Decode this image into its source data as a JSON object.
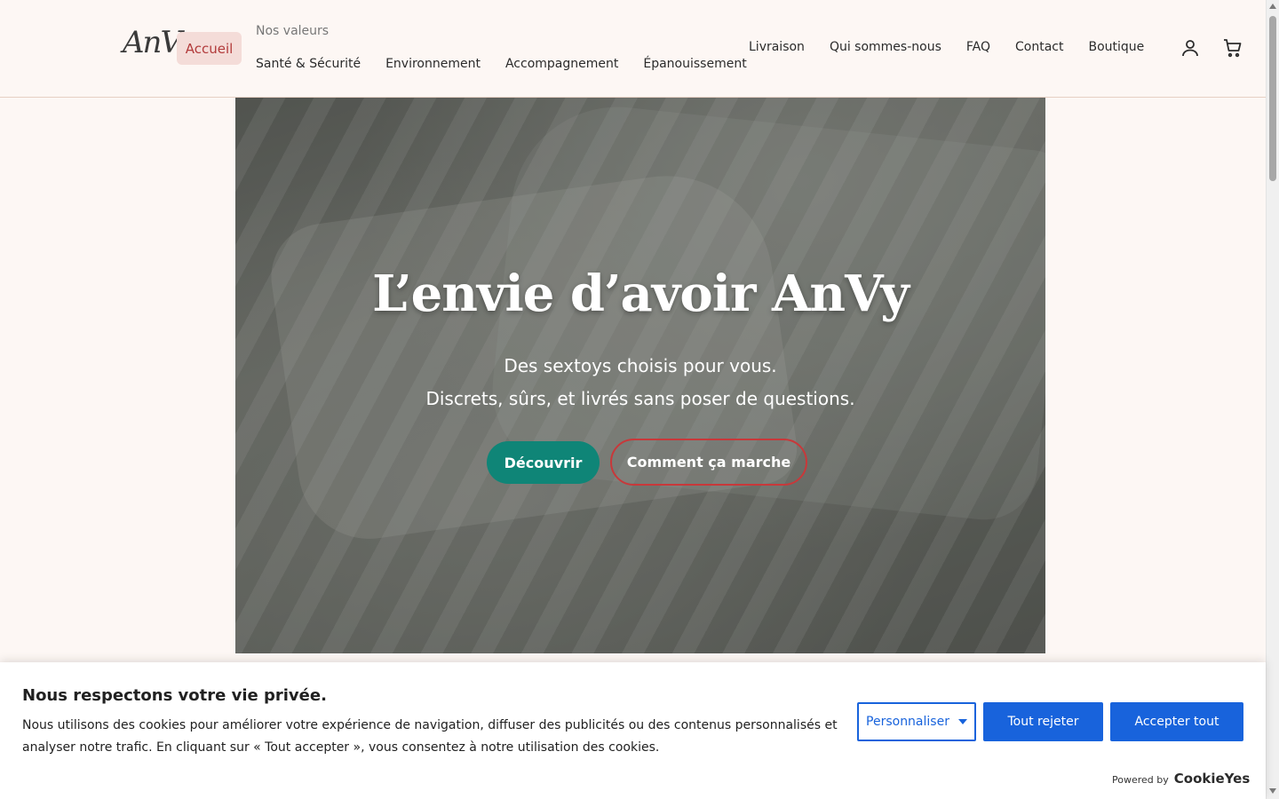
{
  "header": {
    "logo": "AnVy",
    "home": "Accueil",
    "values_title": "Nos valeurs",
    "values": [
      "Santé & Sécurité",
      "Environnement",
      "Accompagnement",
      "Épanouissement"
    ],
    "nav": [
      "Livraison",
      "Qui sommes-nous",
      "FAQ",
      "Contact",
      "Boutique"
    ],
    "icons": {
      "account": "user-icon",
      "cart": "cart-icon"
    }
  },
  "hero": {
    "title": "L’envie d’avoir AnVy",
    "subtitle_line1": "Des sextoys choisis pour vous.",
    "subtitle_line2": "Discrets, sûrs, et livrés sans poser de questions.",
    "primary_button": "Découvrir",
    "secondary_button": "Comment ça marche"
  },
  "cookie_banner": {
    "title": "Nous respectons votre vie privée.",
    "text": "Nous utilisons des cookies pour améliorer votre expérience de navigation, diffuser des publicités ou des contenus personnalisés et analyser notre trafic. En cliquant sur « Tout accepter », vous consentez à notre utilisation des cookies.",
    "customize": "Personnaliser",
    "reject": "Tout rejeter",
    "accept": "Accepter tout",
    "powered_label": "Powered by",
    "powered_brand": "CookieYes"
  },
  "colors": {
    "background": "#fdf7f4",
    "accent_red": "#b23b3b",
    "teal": "#0f8577",
    "cookie_blue": "#1863dc"
  }
}
